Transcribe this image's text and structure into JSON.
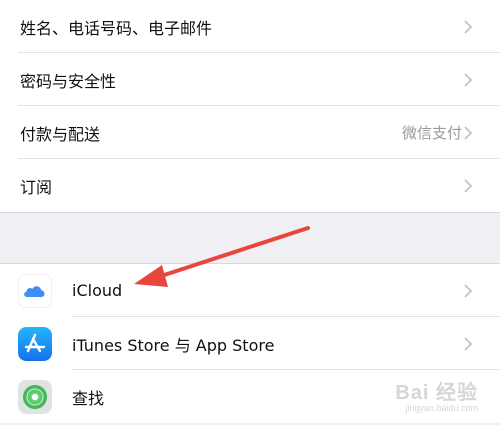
{
  "settings_group_1": {
    "items": [
      {
        "label": "姓名、电话号码、电子邮件",
        "value": ""
      },
      {
        "label": "密码与安全性",
        "value": ""
      },
      {
        "label": "付款与配送",
        "value": "微信支付"
      },
      {
        "label": "订阅",
        "value": ""
      }
    ]
  },
  "settings_group_2": {
    "items": [
      {
        "label": "iCloud",
        "icon": "icloud-icon"
      },
      {
        "label": "iTunes Store 与 App Store",
        "icon": "app-store-icon"
      },
      {
        "label": "查找",
        "icon": "find-my-icon"
      }
    ]
  },
  "annotation": {
    "arrow_color": "#e8453c",
    "points_to": "iCloud"
  },
  "watermark": {
    "main": "Bai 经验",
    "sub": "jingyan.baidu.com"
  },
  "colors": {
    "background": "#efeff4",
    "chevron": "#c4c4c8",
    "secondary_text": "#9a9a9f",
    "icloud_blue": "#3d8ff5",
    "app_store_blue": "#1e8ff4",
    "find_my_green": "#45c160"
  }
}
